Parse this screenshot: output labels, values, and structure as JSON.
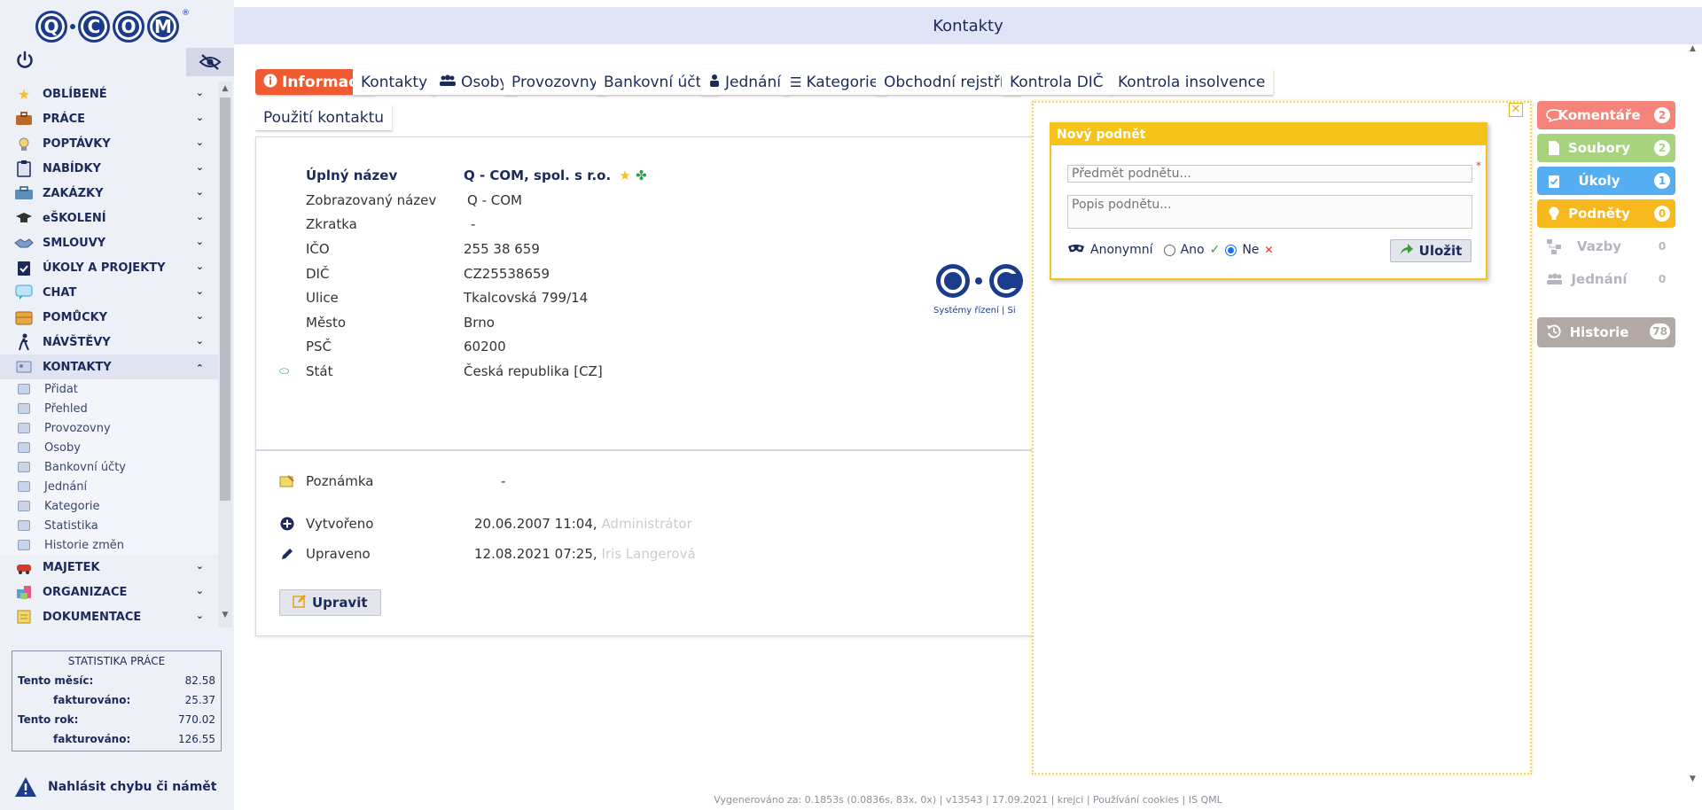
{
  "app": {
    "logo_letters": [
      "Q",
      "C",
      "O",
      "M"
    ],
    "logo_reg": "®",
    "title": "Kontakty"
  },
  "sidebar": {
    "items": [
      {
        "label": "OBLÍBENÉ",
        "icon": "star-icon"
      },
      {
        "label": "PRÁCE",
        "icon": "briefcase-icon"
      },
      {
        "label": "POPTÁVKY",
        "icon": "lightbulb-icon"
      },
      {
        "label": "NABÍDKY",
        "icon": "clipboard-icon"
      },
      {
        "label": "ZAKÁZKY",
        "icon": "toolbox-icon"
      },
      {
        "label": "eŠKOLENÍ",
        "icon": "graduation-cap-icon"
      },
      {
        "label": "SMLOUVY",
        "icon": "handshake-icon"
      },
      {
        "label": "ÚKOLY A PROJEKTY",
        "icon": "clipboard-check-icon"
      },
      {
        "label": "CHAT",
        "icon": "chat-bubble-icon"
      },
      {
        "label": "POMŮCKY",
        "icon": "box-icon"
      },
      {
        "label": "NÁVŠTĚVY",
        "icon": "walking-person-icon"
      },
      {
        "label": "KONTAKTY",
        "icon": "contact-card-icon"
      }
    ],
    "kontakty_sub": [
      "Přidat",
      "Přehled",
      "Provozovny",
      "Osoby",
      "Bankovní účty",
      "Jednání",
      "Kategorie",
      "Statistika",
      "Historie změn"
    ],
    "items_after": [
      {
        "label": "MAJETEK",
        "icon": "car-icon"
      },
      {
        "label": "ORGANIZACE",
        "icon": "cubes-icon"
      },
      {
        "label": "DOKUMENTACE",
        "icon": "document-icon"
      }
    ]
  },
  "stats": {
    "title": "STATISTIKA PRÁCE",
    "month_label": "Tento měsíc:",
    "month_value": "82.58",
    "month_invoiced_label": "fakturováno:",
    "month_invoiced_value": "25.37",
    "year_label": "Tento rok:",
    "year_value": "770.02",
    "year_invoiced_label": "fakturováno:",
    "year_invoiced_value": "126.55"
  },
  "report": {
    "label": "Nahlásit chybu či námět"
  },
  "tabs": [
    {
      "label": "Informace",
      "icon": "info-icon"
    },
    {
      "label": "Kontakty",
      "icon": ""
    },
    {
      "label": "Osoby",
      "icon": "users-icon"
    },
    {
      "label": "Provozovny",
      "icon": ""
    },
    {
      "label": "Bankovní účty",
      "icon": ""
    },
    {
      "label": "Jednání",
      "icon": "person-icon"
    },
    {
      "label": "Kategorie",
      "icon": "list-icon"
    },
    {
      "label": "Obchodní rejstřík",
      "icon": ""
    },
    {
      "label": "Kontrola DIČ",
      "icon": ""
    },
    {
      "label": "Kontrola insolvence",
      "icon": ""
    },
    {
      "label": "Použití kontaktu",
      "icon": ""
    }
  ],
  "info": {
    "full_name_label": "Úplný název",
    "full_name_value": "Q - COM, spol. s r.o.",
    "display_name_label": "Zobrazovaný název",
    "display_name_value": "Q - COM",
    "abbrev_label": "Zkratka",
    "abbrev_value": "-",
    "ico_label": "IČO",
    "ico_value": "255 38 659",
    "dic_label": "DIČ",
    "dic_value": "CZ25538659",
    "street_label": "Ulice",
    "street_value": "Tkalcovská 799/14",
    "city_label": "Město",
    "city_value": "Brno",
    "zip_label": "PSČ",
    "zip_value": "60200",
    "country_label": "Stát",
    "country_value": "Česká republika [CZ]",
    "logo_tagline": "Systémy řízení | Si"
  },
  "meta": {
    "note_label": "Poznámka",
    "note_value": "-",
    "created_label": "Vytvořeno",
    "created_value": "20.06.2007 11:04,",
    "created_user": "Administrátor",
    "modified_label": "Upraveno",
    "modified_value": "12.08.2021 07:25,",
    "modified_user": "Iris Langerová",
    "edit_label": "Upravit"
  },
  "popup": {
    "title": "Nový podnět",
    "subject_placeholder": "Předmět podnětu...",
    "desc_placeholder": "Popis podnětu...",
    "required_mark": "*",
    "anon_label": "Anonymní",
    "yes_label": "Ano",
    "no_label": "Ne",
    "save_label": "Uložit",
    "close_glyph": "✕"
  },
  "right_panel": [
    {
      "label": "Komentáře",
      "count": "2",
      "color": "#f4837a",
      "icon": "comment-icon"
    },
    {
      "label": "Soubory",
      "count": "2",
      "color": "#a7d37f",
      "icon": "file-icon"
    },
    {
      "label": "Úkoly",
      "count": "1",
      "color": "#56aef2",
      "icon": "task-icon"
    },
    {
      "label": "Podněty",
      "count": "0",
      "color": "#f6b81c",
      "icon": "bulb-icon"
    },
    {
      "label": "Vazby",
      "count": "0",
      "color": "",
      "icon": "network-icon"
    },
    {
      "label": "Jednání",
      "count": "0",
      "color": "",
      "icon": "group-icon"
    },
    {
      "label": "Historie",
      "count": "78",
      "color": "#b2a8a6",
      "icon": "history-icon"
    }
  ],
  "footer": {
    "text": "Vygenerováno za: 0.1853s (0.0836s, 83x, 0x) | v13543 | 17.09.2021 | krejci | Používání cookies | IS QML"
  },
  "colors": {
    "accent": "#f05a32",
    "brand": "#1b3b8b",
    "popup": "#f5c31a"
  }
}
